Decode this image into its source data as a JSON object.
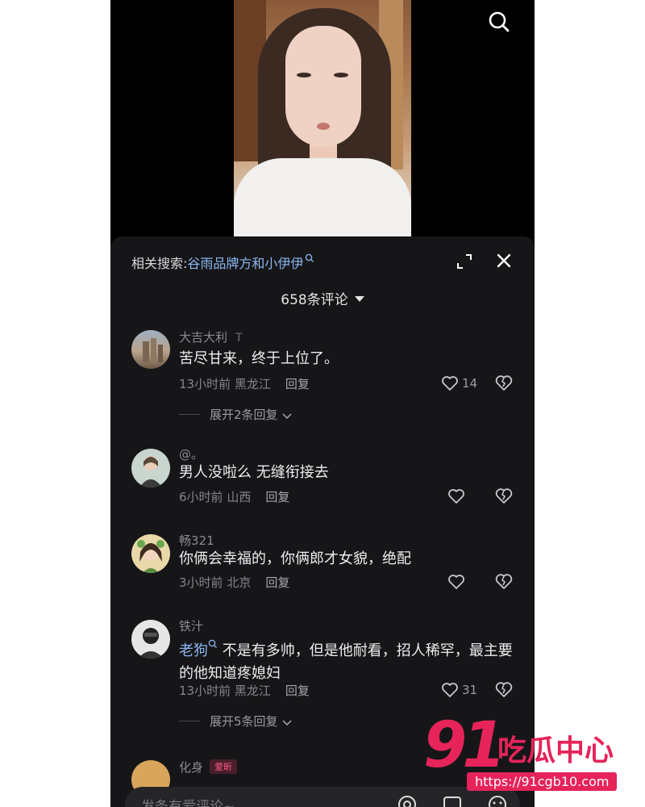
{
  "related": {
    "label": "相关搜索:",
    "query": "谷雨品牌方和小伊伊"
  },
  "comments_count": "658条评论",
  "comments": [
    {
      "user": "大吉大利",
      "tag": "T",
      "text": "苦尽甘来，终于上位了。",
      "time": "13小时前",
      "location": "黑龙江",
      "reply_label": "回复",
      "likes": "14",
      "more_replies": "展开2条回复"
    },
    {
      "user": "@。",
      "tag": "",
      "text": "男人没啦么 无缝衔接去",
      "time": "6小时前",
      "location": "山西",
      "reply_label": "回复",
      "likes": ""
    },
    {
      "user": "畅321",
      "tag": "",
      "text": "你俩会幸福的，你俩郎才女貌，绝配",
      "time": "3小时前",
      "location": "北京",
      "reply_label": "回复",
      "likes": ""
    },
    {
      "user": "铁汁",
      "tag": "",
      "mention": "老狗",
      "text": "不是有多帅，但是他耐看，招人稀罕，最主要的他知道疼媳妇",
      "time": "13小时前",
      "location": "黑龙江",
      "reply_label": "回复",
      "likes": "31",
      "more_replies": "展开5条回复"
    },
    {
      "user": "化身",
      "badge": "爱昕"
    }
  ],
  "input": {
    "placeholder": "发条有爱评论~"
  },
  "watermark": {
    "number": "91",
    "text": "吃瓜中心",
    "url": "https://91cgb10.com"
  },
  "colors": {
    "link": "#8bb6f0",
    "brand": "#e6245a",
    "panel_bg": "#161618"
  }
}
